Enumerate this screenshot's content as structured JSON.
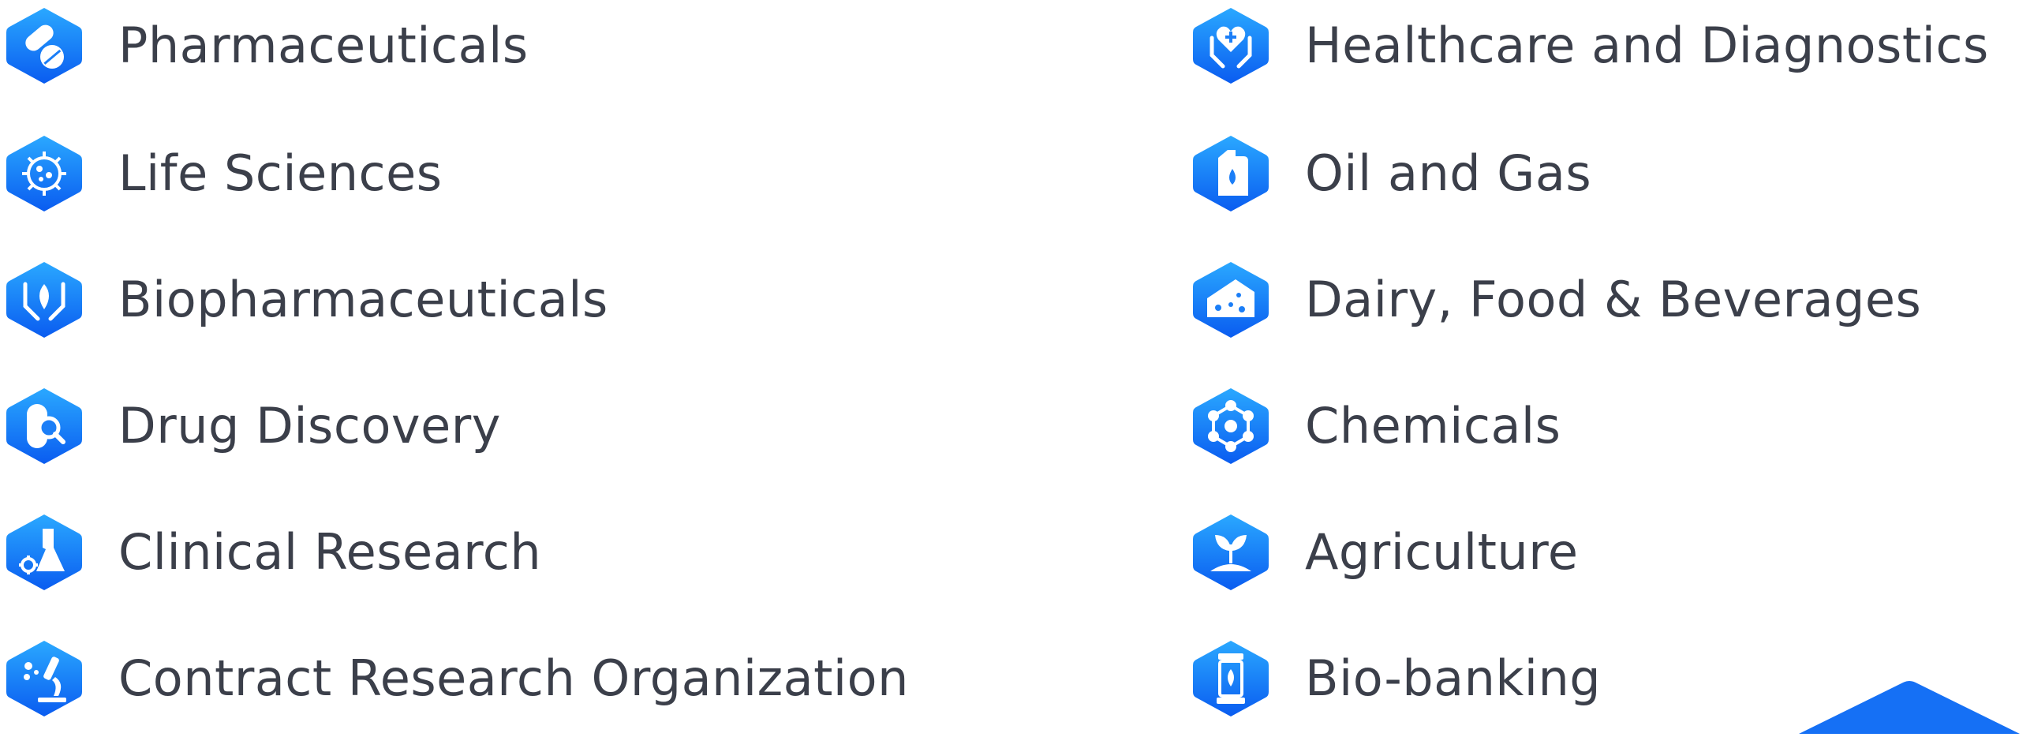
{
  "left_column": [
    {
      "label": "Pharmaceuticals",
      "icon": "pill-capsule-icon"
    },
    {
      "label": "Life Sciences",
      "icon": "virus-cell-icon"
    },
    {
      "label": "Biopharmaceuticals",
      "icon": "hands-leaf-icon"
    },
    {
      "label": "Drug Discovery",
      "icon": "capsule-magnifier-icon"
    },
    {
      "label": "Clinical Research",
      "icon": "flask-gear-icon"
    },
    {
      "label": "Contract Research Organization",
      "icon": "microscope-icon"
    }
  ],
  "right_column": [
    {
      "label": "Healthcare and Diagnostics",
      "icon": "hands-heart-icon"
    },
    {
      "label": "Oil and Gas",
      "icon": "oil-can-icon"
    },
    {
      "label": "Dairy, Food & Beverages",
      "icon": "cheese-icon"
    },
    {
      "label": "Chemicals",
      "icon": "molecule-icon"
    },
    {
      "label": "Agriculture",
      "icon": "sprout-icon"
    },
    {
      "label": "Bio-banking",
      "icon": "biobank-jar-icon"
    }
  ],
  "colors": {
    "icon_gradient_top": "#2aa8ff",
    "icon_gradient_bottom": "#0a5cf0",
    "text": "#3b3f4a",
    "corner_accent": "#1570f5"
  }
}
